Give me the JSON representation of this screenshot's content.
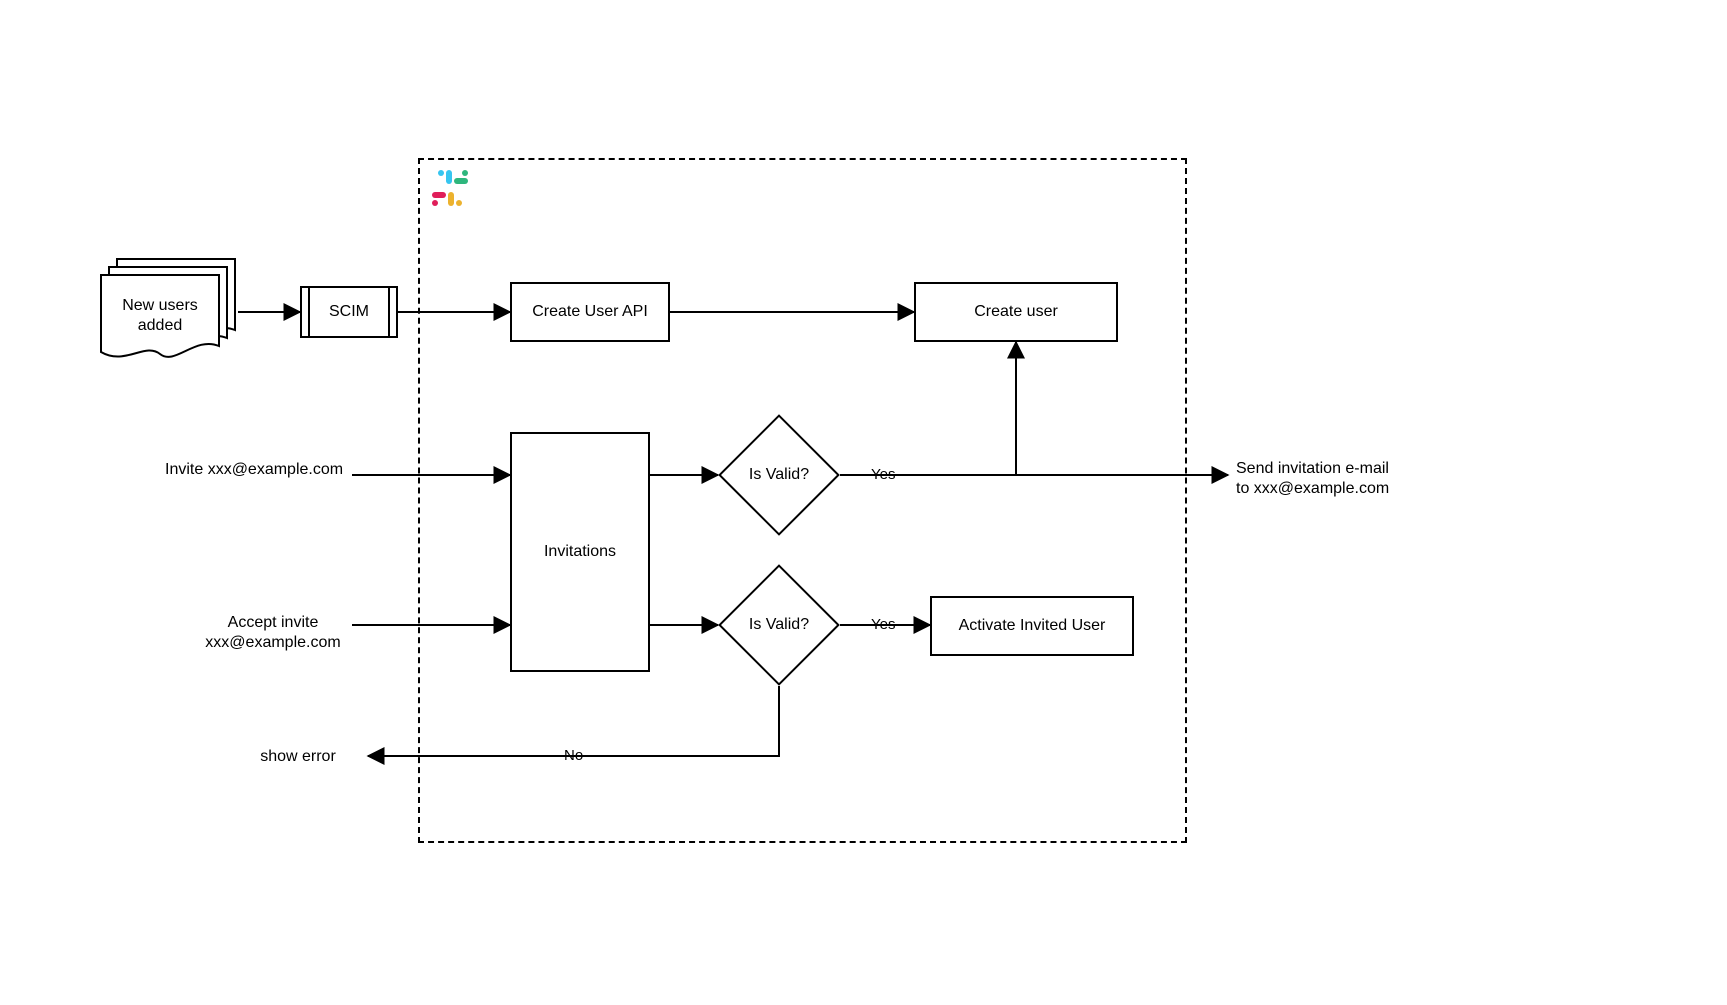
{
  "nodes": {
    "new_users": "New users\nadded",
    "scim": "SCIM",
    "create_user_api": "Create User API",
    "create_user": "Create user",
    "invitations": "Invitations",
    "is_valid_1": "Is Valid?",
    "is_valid_2": "Is Valid?",
    "activate_invited_user": "Activate Invited User"
  },
  "external_labels": {
    "invite": "Invite xxx@example.com",
    "accept": "Accept invite\nxxx@example.com",
    "show_error": "show error",
    "send_invite": "Send invitation e-mail\nto xxx@example.com"
  },
  "edge_labels": {
    "yes1": "Yes",
    "yes2": "Yes",
    "no": "No"
  },
  "icons": {
    "slack": "slack-icon"
  }
}
